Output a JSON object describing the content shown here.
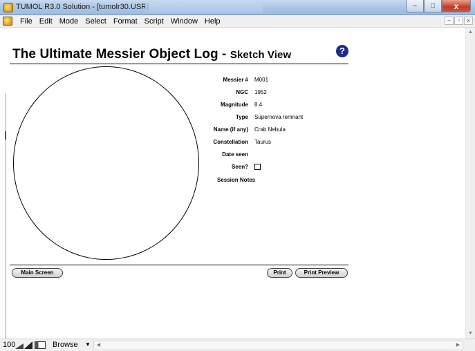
{
  "window": {
    "title": "TUMOL R3.0 Solution - [tumolr30.USR]",
    "minimize": "–",
    "maximize": "□",
    "close": "x"
  },
  "menu": {
    "items": [
      "File",
      "Edit",
      "Mode",
      "Select",
      "Format",
      "Script",
      "Window",
      "Help"
    ],
    "mdi_min": "–",
    "mdi_restore": "▫",
    "mdi_close": "x"
  },
  "page": {
    "title": "The Ultimate Messier Object Log - ",
    "subtitle": "Sketch View",
    "help_glyph": "?"
  },
  "fields": [
    {
      "label": "Messier #",
      "value": "M001"
    },
    {
      "label": "NGC",
      "value": "1952"
    },
    {
      "label": "Magnitude",
      "value": "8.4"
    },
    {
      "label": "Type",
      "value": "Supernova remnant"
    },
    {
      "label": "Name (if any)",
      "value": "Crab Nebula"
    },
    {
      "label": "Constellation",
      "value": "Taurus"
    },
    {
      "label": "Date seen",
      "value": ""
    }
  ],
  "seen": {
    "label": "Seen?",
    "checked": false
  },
  "notes": {
    "label": "Session Notes"
  },
  "buttons": {
    "main_screen": "Main Screen",
    "print": "Print",
    "print_preview": "Print Preview"
  },
  "statusbar": {
    "zoom": "100",
    "mode": "Browse"
  },
  "icons": {
    "app": "app-icon",
    "help": "help-icon",
    "zoom_out": "zoom-out-icon",
    "zoom_in": "zoom-in-icon",
    "status_toggle": "status-area-toggle-icon"
  },
  "colors": {
    "help_icon": "#1d2a8c",
    "close_button": "#c43b1f"
  }
}
